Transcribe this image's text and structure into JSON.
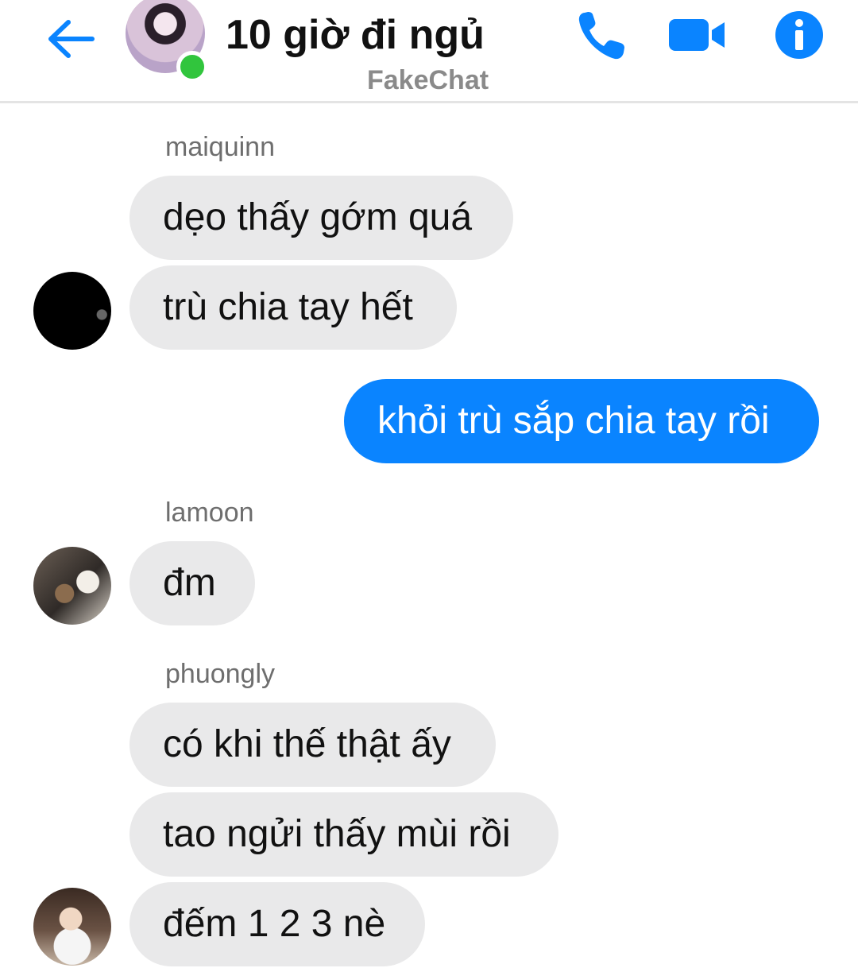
{
  "header": {
    "title": "10 giờ đi ngủ",
    "subtitle": "FakeChat",
    "back_icon": "arrow-left-icon",
    "call_icon": "phone-icon",
    "video_icon": "video-camera-icon",
    "info_icon": "info-icon",
    "online": true,
    "accent_color": "#0a84ff",
    "online_color": "#31c53d"
  },
  "messages": [
    {
      "sender": "maiquinn",
      "texts": [
        "dẹo thấy gớm quá",
        "trù chia tay hết"
      ],
      "direction": "incoming"
    },
    {
      "sender": "",
      "texts": [
        "khỏi trù sắp chia tay rồi"
      ],
      "direction": "outgoing"
    },
    {
      "sender": "lamoon",
      "texts": [
        "đm"
      ],
      "direction": "incoming"
    },
    {
      "sender": "phuongly",
      "texts": [
        "có khi thế thật ấy",
        "tao ngửi thấy mùi rồi",
        "đếm 1 2 3 nè"
      ],
      "direction": "incoming"
    }
  ],
  "colors": {
    "incoming_bubble": "#e9e9ea",
    "outgoing_bubble": "#0a84ff",
    "sender_name": "#6e6e6e"
  }
}
